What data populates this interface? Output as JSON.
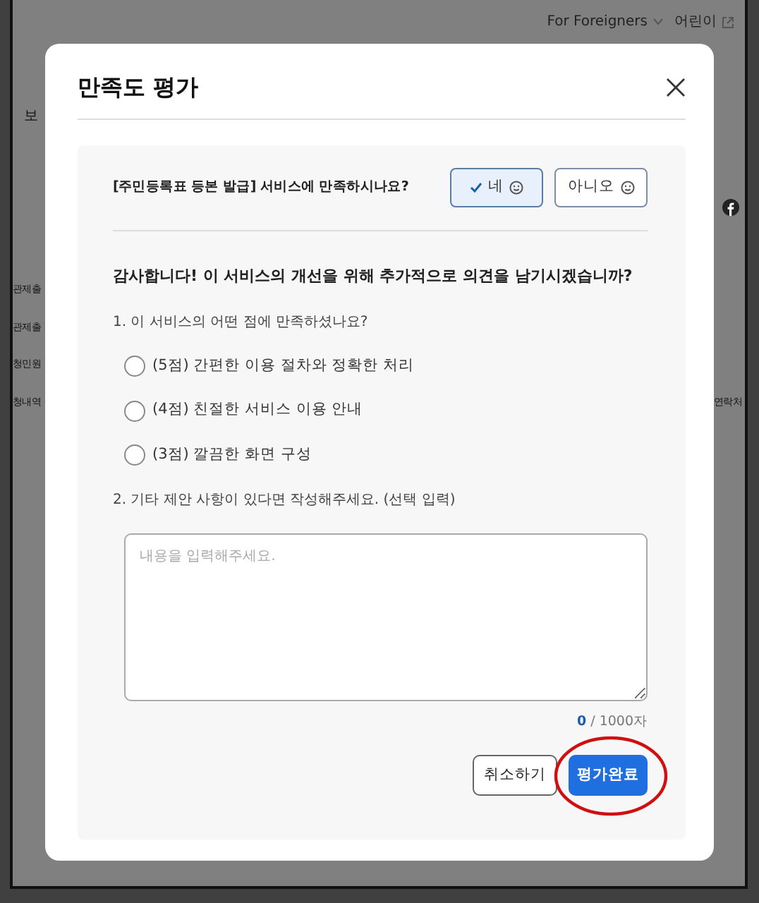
{
  "background": {
    "top_links": [
      {
        "label": "For Foreigners",
        "kind": "dropdown"
      },
      {
        "label": "어린이",
        "kind": "external"
      }
    ],
    "side_tab": "보",
    "sidebar": [
      "관제출",
      "관제출",
      "청민원",
      "청내역"
    ],
    "table_header": "연락처"
  },
  "modal": {
    "title": "만족도 평가",
    "question": "[주민등록표 등본 발급] 서비스에 만족하시나요?",
    "answers": [
      {
        "label": "네",
        "selected": true
      },
      {
        "label": "아니오",
        "selected": false
      }
    ],
    "followup": "감사합니다! 이 서비스의 개선을 위해 추가적으로 의견을 남기시겠습니까?",
    "q1": "1. 이 서비스의 어떤 점에 만족하셨나요?",
    "options": [
      {
        "label": "(5점) 간편한 이용 절차와 정확한 처리",
        "selected": false
      },
      {
        "label": "(4점) 친절한 서비스 이용 안내",
        "selected": false
      },
      {
        "label": "(3점) 깔끔한 화면 구성",
        "selected": false
      }
    ],
    "q2": "2. 기타 제안 사항이 있다면 작성해주세요. (선택 입력)",
    "comment": {
      "placeholder": "내용을 입력해주세요.",
      "count": "0",
      "limit": "/ 1000자"
    },
    "buttons": [
      {
        "label": "취소하기",
        "kind": "secondary",
        "annotated": false
      },
      {
        "label": "평가완료",
        "kind": "primary",
        "annotated": true
      }
    ]
  }
}
